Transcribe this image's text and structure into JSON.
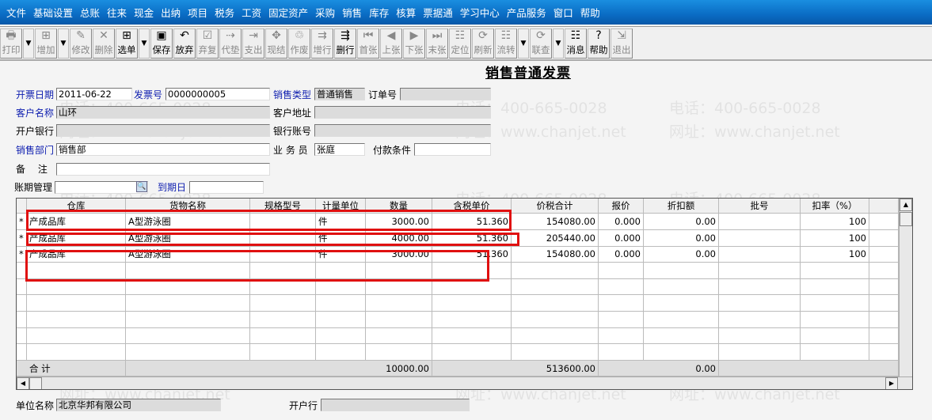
{
  "menu": [
    "文件",
    "基础设置",
    "总账",
    "往来",
    "现金",
    "出纳",
    "项目",
    "税务",
    "工资",
    "固定资产",
    "采购",
    "销售",
    "库存",
    "核算",
    "票据通",
    "学习中心",
    "产品服务",
    "窗口",
    "帮助"
  ],
  "toolbar": [
    {
      "label": "打印",
      "icon": "printer-icon",
      "glyph": "🖶",
      "on": false,
      "dd": true
    },
    {
      "label": "增加",
      "icon": "add-icon",
      "glyph": "⊞",
      "on": false,
      "dd": true
    },
    {
      "label": "修改",
      "icon": "edit-icon",
      "glyph": "✎",
      "on": false
    },
    {
      "label": "删除",
      "icon": "delete-icon",
      "glyph": "✕",
      "on": false
    },
    {
      "label": "选单",
      "icon": "select-doc-icon",
      "glyph": "⊞",
      "on": true,
      "dd": true
    },
    {
      "label": "保存",
      "icon": "save-icon",
      "glyph": "▣",
      "on": true
    },
    {
      "label": "放弃",
      "icon": "undo-icon",
      "glyph": "↶",
      "on": true
    },
    {
      "label": "弃复",
      "icon": "restore-icon",
      "glyph": "☑",
      "on": false
    },
    {
      "label": "代垫",
      "icon": "advance-icon",
      "glyph": "⇢",
      "on": false
    },
    {
      "label": "支出",
      "icon": "expense-icon",
      "glyph": "⇥",
      "on": false
    },
    {
      "label": "现结",
      "icon": "cash-settle-icon",
      "glyph": "✥",
      "on": false
    },
    {
      "label": "作废",
      "icon": "void-icon",
      "glyph": "♲",
      "on": false
    },
    {
      "label": "增行",
      "icon": "add-row-icon",
      "glyph": "⇉",
      "on": false
    },
    {
      "label": "删行",
      "icon": "delete-row-icon",
      "glyph": "⇶",
      "on": true
    },
    {
      "label": "首张",
      "icon": "first-icon",
      "glyph": "⏮",
      "on": false
    },
    {
      "label": "上张",
      "icon": "prev-icon",
      "glyph": "◀",
      "on": false
    },
    {
      "label": "下张",
      "icon": "next-icon",
      "glyph": "▶",
      "on": false
    },
    {
      "label": "末张",
      "icon": "last-icon",
      "glyph": "⏭",
      "on": false
    },
    {
      "label": "定位",
      "icon": "locate-icon",
      "glyph": "☷",
      "on": false
    },
    {
      "label": "刷新",
      "icon": "refresh-icon",
      "glyph": "⟳",
      "on": false
    },
    {
      "label": "流转",
      "icon": "flow-icon",
      "glyph": "☷",
      "on": false,
      "dd": true
    },
    {
      "label": "联查",
      "icon": "link-query-icon",
      "glyph": "⟳",
      "on": false,
      "dd": true
    },
    {
      "label": "消息",
      "icon": "message-icon",
      "glyph": "☷",
      "on": true
    },
    {
      "label": "帮助",
      "icon": "help-icon",
      "glyph": "?",
      "on": true
    },
    {
      "label": "退出",
      "icon": "exit-icon",
      "glyph": "⇲",
      "on": false
    }
  ],
  "title": "销售普通发票",
  "form": {
    "invoice_date_label": "开票日期",
    "invoice_date": "2011-06-22",
    "invoice_no_label": "发票号",
    "invoice_no": "0000000005",
    "sales_type_label": "销售类型",
    "sales_type": "普通销售",
    "order_no_label": "订单号",
    "order_no": "",
    "customer_label": "客户名称",
    "customer": "山环",
    "address_label": "客户地址",
    "address": "",
    "bank_label": "开户银行",
    "bank": "",
    "account_label": "银行账号",
    "account": "",
    "dept_label": "销售部门",
    "dept": "销售部",
    "salesman_label": "业 务 员",
    "salesman": "张庭",
    "payment_label": "付款条件",
    "payment": "",
    "remark_label": "备　 注",
    "remark": "",
    "term_label": "账期管理",
    "term": "",
    "due_label": "到期日",
    "due": ""
  },
  "grid": {
    "columns": [
      "仓库",
      "货物名称",
      "规格型号",
      "计量单位",
      "数量",
      "含税单价",
      "价税合计",
      "报价",
      "折扣额",
      "批号",
      "扣率（%）"
    ],
    "rows": [
      [
        "产成品库",
        "A型游泳圈",
        "",
        "件",
        "3000.00",
        "51.360",
        "154080.00",
        "0.000",
        "0.00",
        "",
        "100"
      ],
      [
        "产成品库",
        "A型游泳圈",
        "",
        "件",
        "4000.00",
        "51.360",
        "205440.00",
        "0.000",
        "0.00",
        "",
        "100"
      ],
      [
        "产成品库",
        "A型游泳圈",
        "",
        "件",
        "3000.00",
        "51.360",
        "154080.00",
        "0.000",
        "0.00",
        "",
        "100"
      ]
    ],
    "row_marker": "*",
    "total_label": "合 计",
    "total_qty": "10000.00",
    "total_amount": "513600.00",
    "total_discount": "0.00"
  },
  "footer": {
    "company_label": "单位名称",
    "company": "北京华邦有限公司",
    "bank_label": "开户行",
    "bank": ""
  },
  "watermark": {
    "phone": "电话：400-665-0028",
    "web": "网址：www.chanjet.net"
  }
}
